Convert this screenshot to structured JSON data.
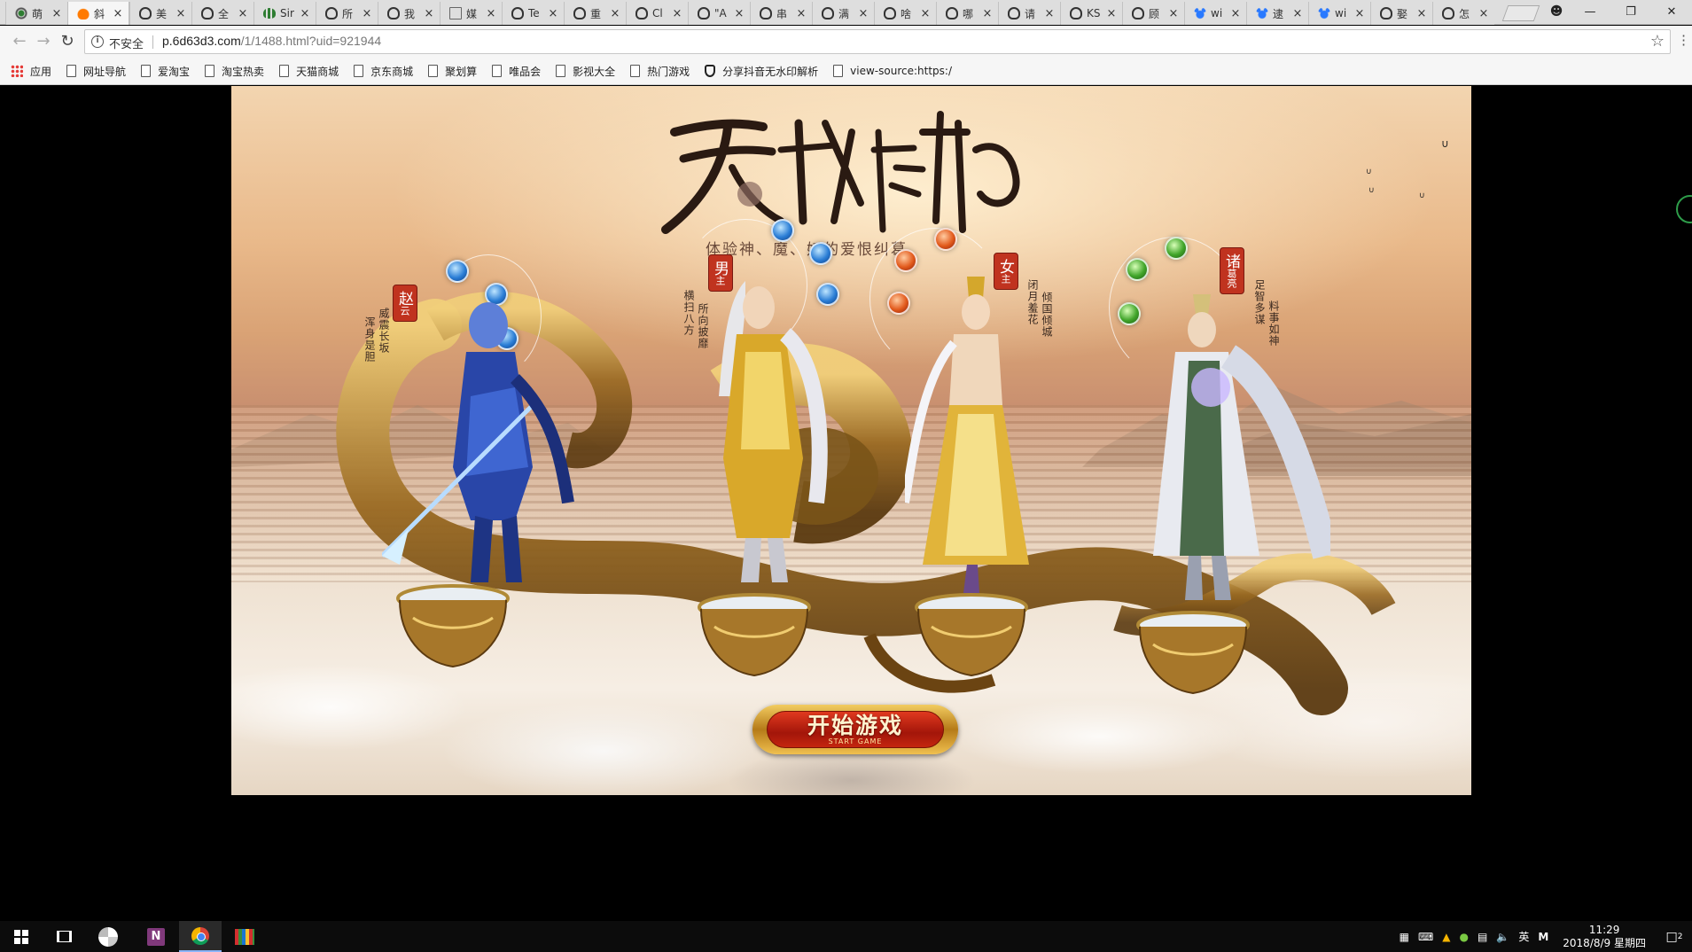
{
  "browser": {
    "tabs": [
      {
        "label": "萌",
        "icon": "eye-icon"
      },
      {
        "label": "斜",
        "icon": "fire-icon",
        "active": true
      },
      {
        "label": "美",
        "icon": "shield-icon"
      },
      {
        "label": "全",
        "icon": "shield-icon"
      },
      {
        "label": "Sir",
        "icon": "chart-icon"
      },
      {
        "label": "所",
        "icon": "shield-icon"
      },
      {
        "label": "我",
        "icon": "shield-icon"
      },
      {
        "label": "媒",
        "icon": "doc-icon"
      },
      {
        "label": "Te",
        "icon": "shield-icon"
      },
      {
        "label": "重",
        "icon": "shield-icon"
      },
      {
        "label": "Cl",
        "icon": "shield-icon"
      },
      {
        "label": "\"A",
        "icon": "shield-icon"
      },
      {
        "label": "串",
        "icon": "shield-icon"
      },
      {
        "label": "满",
        "icon": "shield-icon"
      },
      {
        "label": "啥",
        "icon": "shield-icon"
      },
      {
        "label": "哪",
        "icon": "shield-icon"
      },
      {
        "label": "请",
        "icon": "shield-icon"
      },
      {
        "label": "KS",
        "icon": "shield-icon"
      },
      {
        "label": "顾",
        "icon": "shield-icon"
      },
      {
        "label": "wi",
        "icon": "paw-icon"
      },
      {
        "label": "逮",
        "icon": "paw-icon"
      },
      {
        "label": "wi",
        "icon": "paw-icon"
      },
      {
        "label": "娶",
        "icon": "shield-icon"
      },
      {
        "label": "怎",
        "icon": "shield-icon"
      }
    ],
    "address": {
      "security_label": "不安全",
      "url_host": "p.6d63d3.com",
      "url_path": "/1/1488.html?uid=921944"
    },
    "bookmarks": [
      {
        "label": "应用",
        "icon": "apps-icon"
      },
      {
        "label": "网址导航",
        "icon": "page-icon"
      },
      {
        "label": "爱淘宝",
        "icon": "page-icon"
      },
      {
        "label": "淘宝热卖",
        "icon": "page-icon"
      },
      {
        "label": "天猫商城",
        "icon": "page-icon"
      },
      {
        "label": "京东商城",
        "icon": "page-icon"
      },
      {
        "label": "聚划算",
        "icon": "page-icon"
      },
      {
        "label": "唯品会",
        "icon": "page-icon"
      },
      {
        "label": "影视大全",
        "icon": "page-icon"
      },
      {
        "label": "热门游戏",
        "icon": "page-icon"
      },
      {
        "label": "分享抖音无水印解析",
        "icon": "shield-icon"
      },
      {
        "label": "view-source:https:/",
        "icon": "page-icon"
      }
    ]
  },
  "game": {
    "tagline": "体验神、魔、妖的爱恨纠葛",
    "characters": [
      {
        "label_main": "赵",
        "label_sub": "云",
        "desc_left": "浑身是胆",
        "desc_right": "威震长坂"
      },
      {
        "label_main": "男",
        "label_sub": "主",
        "desc_left": "横扫八方",
        "desc_right": "所向披靡"
      },
      {
        "label_main": "女",
        "label_sub": "主",
        "desc_left": "闭月羞花",
        "desc_right": "倾国倾城"
      },
      {
        "label_main": "诸",
        "label_sub": "葛亮",
        "desc_left": "足智多谋",
        "desc_right": "料事如神"
      }
    ],
    "start_button": {
      "label": "开始游戏",
      "sub": "START GAME"
    }
  },
  "taskbar": {
    "ime": "英",
    "time": "11:29",
    "date": "2018/8/9 星期四",
    "notifications": "2"
  },
  "colors": {
    "label_red": "#c0331f",
    "start_red": "#a3160a",
    "gold": "#c9962e"
  }
}
